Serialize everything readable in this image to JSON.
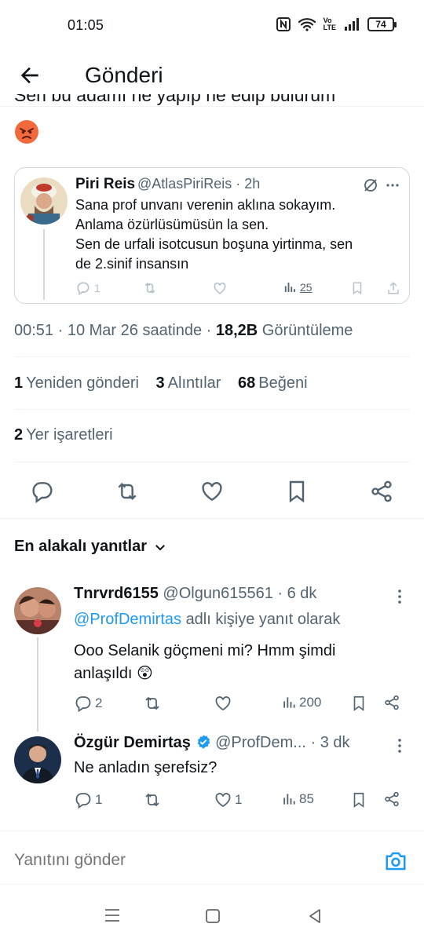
{
  "status": {
    "time": "01:05",
    "battery": "74",
    "volte": "Vo\nLTE"
  },
  "header": {
    "title": "Gönderi"
  },
  "tweet": {
    "cut_text": "Sen bu adamı ne yapıp ne edip bulurum",
    "emoji": "😡"
  },
  "quote": {
    "name": "Piri Reis",
    "handle": "@AtlasPiriReis",
    "time": "2h",
    "lines": [
      "Sana prof unvanı verenin aklına sokayım.",
      "Anlama özürlüsümüsün la sen.",
      "Sen de urfali isotcusun boşuna yirtinma, sen",
      "de 2.sinif insansın"
    ],
    "replies": "1",
    "views": "25"
  },
  "meta": {
    "time": "00:51",
    "date": "10 Mar 26 saatinde",
    "views_count": "18,2B",
    "views_label": "Görüntüleme"
  },
  "stats": {
    "reposts_count": "1",
    "reposts_label": "Yeniden gönderi",
    "quotes_count": "3",
    "quotes_label": "Alıntılar",
    "likes_count": "68",
    "likes_label": "Beğeni",
    "bookmarks_count": "2",
    "bookmarks_label": "Yer işaretleri"
  },
  "replies_header": "En alakalı yanıtlar",
  "replies": [
    {
      "name": "Tnrvrd6155",
      "handle": "@Olgun615561",
      "time": "6 dk",
      "reply_to_mention": "@ProfDemirtas",
      "reply_to_suffix": "adlı kişiye yanıt olarak",
      "lines": [
        "Ooo Selanik göçmeni mi? Hmm şimdi",
        "anlaşıldı 😲"
      ],
      "replies": "2",
      "reposts": "",
      "likes": "",
      "views": "200"
    },
    {
      "name": "Özgür Demirtaş",
      "handle": "@ProfDem...",
      "time": "3 dk",
      "lines": [
        "Ne anladın şerefsiz?"
      ],
      "replies": "1",
      "reposts": "",
      "likes": "1",
      "views": "85"
    }
  ],
  "compose": {
    "placeholder": "Yanıtını gönder"
  },
  "colors": {
    "accent": "#1d9bf0",
    "text": "#0f1419",
    "muted": "#536471",
    "border": "#cfd9de"
  }
}
